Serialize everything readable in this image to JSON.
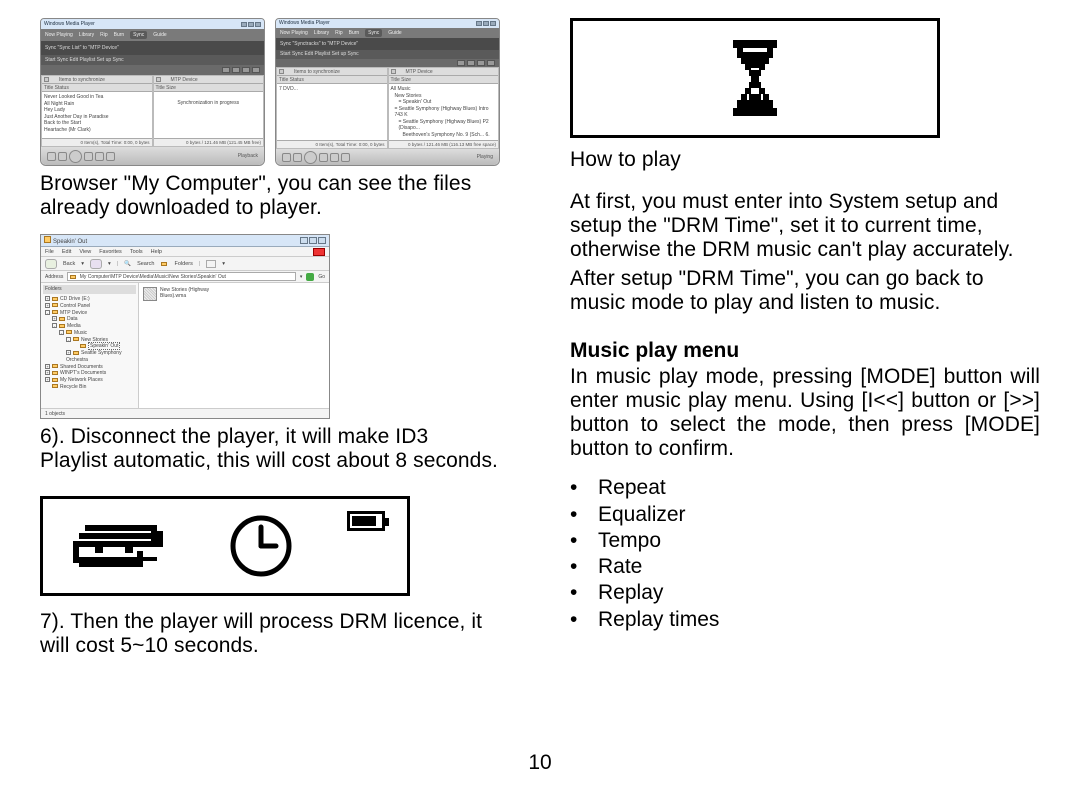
{
  "page_number": "10",
  "left": {
    "wmp_app_title": "Windows Media Player",
    "wmp_tabs": [
      "Now Playing",
      "Library",
      "Rip",
      "Burn",
      "Sync",
      "Guide"
    ],
    "wmp1_sub": "Sync \"Sync List\" to \"MTP Device\"",
    "wmp1_subbar_btns": "Start Sync    Edit Playlist    Set up Sync",
    "wmp1_left_header": "Items to synchronize",
    "wmp1_cols": "Title                Status",
    "wmp1_list": [
      "Never Looked Good in Tea",
      "All Night Rain",
      "Hey Lady",
      "Just Another Day in Paradise",
      "Back to the Start",
      "Heartache (Mr Clark)"
    ],
    "wmp1_left_status": "0 Item(s), Total Time: 0:00, 0 bytes",
    "wmp1_right_header": "MTP Device",
    "wmp1_right_cols": "Title                 Size",
    "wmp1_right_body": "Synchronization in progress",
    "wmp1_right_status": "0 bytes / 121.46 MB (121.45 MB free)",
    "wmp1_note": "Playback",
    "wmp2_sub": "Sync \"Synctracks\" to \"MTP Device\"",
    "wmp2_subbar_btns": "Start Sync    Edit Playlist    Set up Sync",
    "wmp2_left_header": "Items to synchronize",
    "wmp2_cols": "Title                Status",
    "wmp2_list": [
      "7 DVD..."
    ],
    "wmp1_left_status2": "0 Item(s), Total Time: 0:00, 0 bytes",
    "wmp2_right_header": "MTP Device",
    "wmp2_right_cols": "Title                 Size",
    "wmp2_right_tree": [
      "All Music",
      "New Stories",
      "= Speakin' Out",
      "= Seattle Symphony (Highway Blues) Intro   743 K",
      "= Seattle Symphony (Highway Blues) P2 (Disapo...",
      "Beethoven's Symphony No. 9 (Sch...  6."
    ],
    "wmp2_right_status": "0 bytes / 121.46 MB (116.13 MB free space)",
    "wmp2_note": "Playing",
    "para1": "Browser \"My Computer\", you can see the files already downloaded to player.",
    "explorer": {
      "title": "Speakin' Out",
      "menu": [
        "File",
        "Edit",
        "View",
        "Favorites",
        "Tools",
        "Help"
      ],
      "tool_back": "Back",
      "tool_search": "Search",
      "tool_folders": "Folders",
      "addr_label": "Address",
      "addr_value": "My Computer\\MTP Device\\Media\\Music\\New Stories\\Speakin' Out",
      "go": "Go",
      "side_header": "Folders",
      "tree": [
        {
          "lvl": 0,
          "box": "+",
          "icon": "d",
          "label": "CD Drive (E:)"
        },
        {
          "lvl": 0,
          "box": "+",
          "icon": "d",
          "label": "Control Panel"
        },
        {
          "lvl": 0,
          "box": "-",
          "icon": "d",
          "label": "MTP Device"
        },
        {
          "lvl": 1,
          "box": "+",
          "icon": "f",
          "label": "Data"
        },
        {
          "lvl": 1,
          "box": "-",
          "icon": "f",
          "label": "Media"
        },
        {
          "lvl": 2,
          "box": "-",
          "icon": "f",
          "label": "Music"
        },
        {
          "lvl": 3,
          "box": "-",
          "icon": "f",
          "label": "New Stories"
        },
        {
          "lvl": 4,
          "box": "",
          "icon": "f",
          "label": "Speakin' Out",
          "sel": true
        },
        {
          "lvl": 3,
          "box": "+",
          "icon": "f",
          "label": "Seattle Symphony Orchestra"
        },
        {
          "lvl": 0,
          "box": "+",
          "icon": "f",
          "label": "Shared Documents"
        },
        {
          "lvl": 0,
          "box": "+",
          "icon": "f",
          "label": "WINPT's Documents"
        },
        {
          "lvl": 0,
          "box": "+",
          "icon": "d",
          "label": "My Network Places"
        },
        {
          "lvl": 0,
          "box": "",
          "icon": "d",
          "label": "Recycle Bin"
        }
      ],
      "file_line1": "New Stories (Highway",
      "file_line2": "Blues).wma",
      "status_left": "1 objects",
      "status_right": ""
    },
    "para2": "6). Disconnect the player, it will make ID3 Playlist automatic, this will cost about 8 seconds.",
    "para3": "7). Then the player will process DRM licence, it will cost 5~10 seconds."
  },
  "right": {
    "para_howto": "How to play",
    "para_drm1": "At first, you must enter into System setup and setup the \"DRM Time\", set it to current time, otherwise the DRM music can't play accurately.",
    "para_drm2": "After setup \"DRM Time\", you can go back to music mode to play and listen to music.",
    "heading_menu": "Music play menu",
    "para_menu": "In music play mode, pressing [MODE] button will enter music play menu. Using [I<<] button or [>>] button to select the mode, then press [MODE] button to confirm.",
    "menu_items": [
      "Repeat",
      "Equalizer",
      "Tempo",
      "Rate",
      "Replay",
      "Replay times"
    ]
  }
}
